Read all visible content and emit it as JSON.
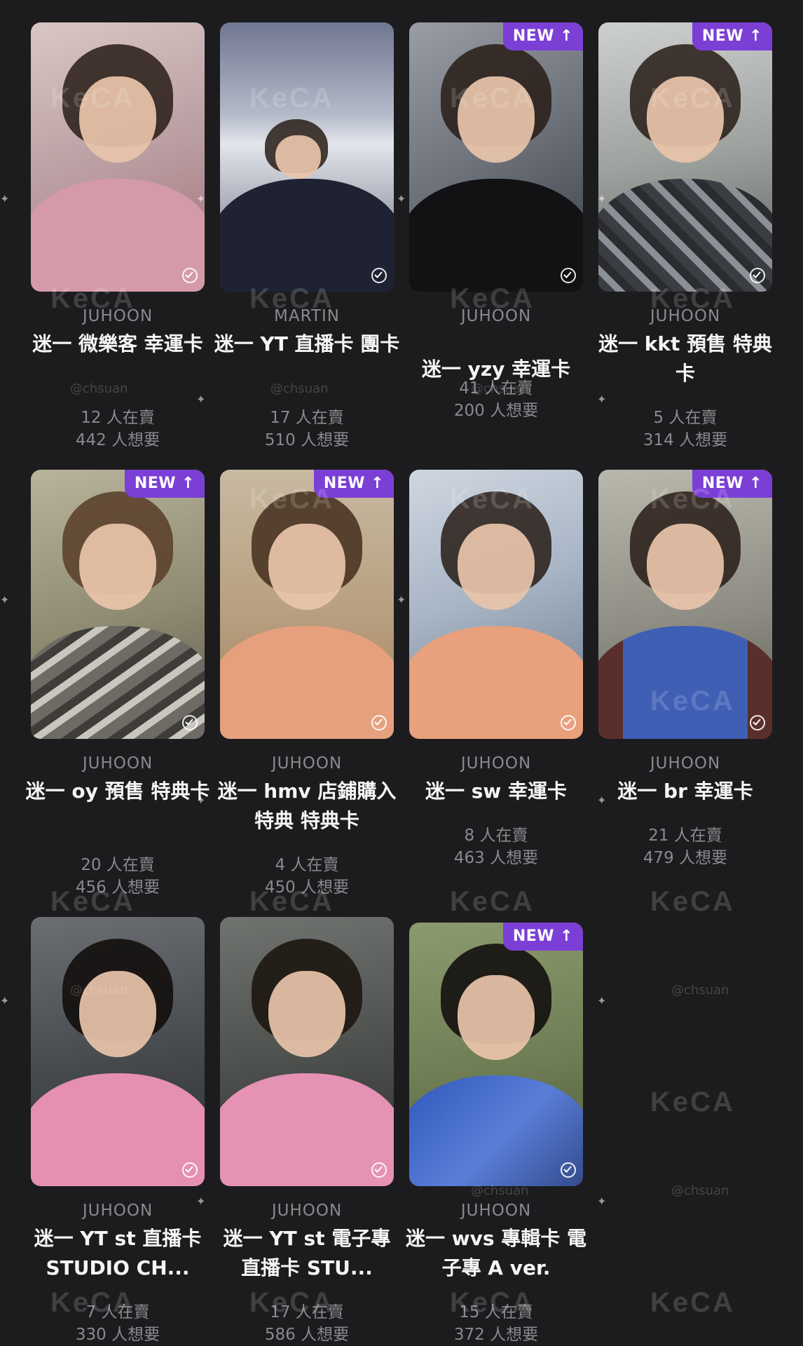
{
  "badge": {
    "label": "NEW",
    "arrow": "↑"
  },
  "watermark": {
    "logo": "KeCA",
    "handle": "@chsuan"
  },
  "cards": [
    {
      "member": "JUHOON",
      "title": "迷一 微樂客 幸運卡",
      "sellers": "12 人在賣",
      "wants": "442 人想要",
      "new": false
    },
    {
      "member": "MARTIN",
      "title": "迷一 YT 直播卡 團卡",
      "sellers": "17 人在賣",
      "wants": "510 人想要",
      "new": false
    },
    {
      "member": "JUHOON",
      "title": "迷一 yzy 幸運卡",
      "sellers": "41 人在賣",
      "wants": "200 人想要",
      "new": true
    },
    {
      "member": "JUHOON",
      "title": "迷一 kkt 預售 特典卡",
      "sellers": "5 人在賣",
      "wants": "314 人想要",
      "new": true
    },
    {
      "member": "JUHOON",
      "title": "迷一 oy 預售 特典卡",
      "sellers": "20 人在賣",
      "wants": "456 人想要",
      "new": true
    },
    {
      "member": "JUHOON",
      "title": "迷一 hmv 店鋪購入特典 特典卡",
      "sellers": "4 人在賣",
      "wants": "450 人想要",
      "new": true
    },
    {
      "member": "JUHOON",
      "title": "迷一 sw 幸運卡",
      "sellers": "8 人在賣",
      "wants": "463 人想要",
      "new": false
    },
    {
      "member": "JUHOON",
      "title": "迷一 br 幸運卡",
      "sellers": "21 人在賣",
      "wants": "479 人想要",
      "new": true
    },
    {
      "member": "JUHOON",
      "title": "迷一 YT st 直播卡 STUDIO CH...",
      "sellers": "7 人在賣",
      "wants": "330 人想要",
      "new": false
    },
    {
      "member": "JUHOON",
      "title": "迷一 YT st 電子專 直播卡 STU...",
      "sellers": "17 人在賣",
      "wants": "586 人想要",
      "new": false
    },
    {
      "member": "JUHOON",
      "title": "迷一 wvs 專輯卡 電子專 A ver.",
      "sellers": "15 人在賣",
      "wants": "372 人想要",
      "new": true
    }
  ],
  "colors": {
    "background": "#1c1c1e",
    "badge": "#7b3fd6",
    "title": "#f5f5f5",
    "meta": "#8a8a8e"
  }
}
